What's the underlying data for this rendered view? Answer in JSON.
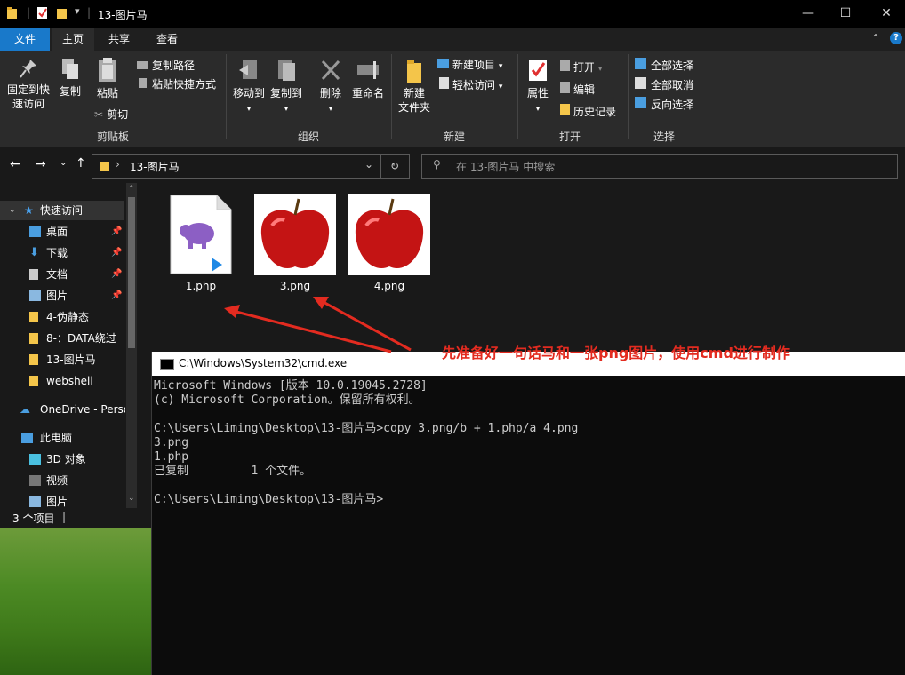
{
  "window": {
    "title": "13-图片马"
  },
  "ribbon_tabs": [
    "文件",
    "主页",
    "共享",
    "查看"
  ],
  "ribbon": {
    "pin_line1": "固定到快",
    "pin_line2": "速访问",
    "copy": "复制",
    "paste": "粘贴",
    "copy_path": "复制路径",
    "paste_shortcut": "粘贴快捷方式",
    "cut": "剪切",
    "group_clipboard": "剪贴板",
    "move_to": "移动到",
    "copy_to": "复制到",
    "delete": "删除",
    "rename": "重命名",
    "group_organize": "组织",
    "new_folder_line1": "新建",
    "new_folder_line2": "文件夹",
    "new_item": "新建项目",
    "easy_access": "轻松访问",
    "group_new": "新建",
    "properties": "属性",
    "open": "打开",
    "edit": "编辑",
    "history": "历史记录",
    "group_open": "打开",
    "select_all": "全部选择",
    "select_none": "全部取消",
    "invert_selection": "反向选择",
    "group_select": "选择"
  },
  "address": {
    "path": "13-图片马",
    "search_placeholder": "在 13-图片马 中搜索"
  },
  "sidebar": {
    "quick_access": "快速访问",
    "items": [
      {
        "label": "桌面",
        "pinned": true
      },
      {
        "label": "下载",
        "pinned": true
      },
      {
        "label": "文档",
        "pinned": true
      },
      {
        "label": "图片",
        "pinned": true
      },
      {
        "label": "4-伪静态",
        "pinned": false
      },
      {
        "label": "8-：DATA绕过",
        "pinned": false
      },
      {
        "label": "13-图片马",
        "pinned": false
      },
      {
        "label": "webshell",
        "pinned": false
      }
    ],
    "onedrive": "OneDrive - Perso",
    "this_pc": "此电脑",
    "pc_items": [
      "3D 对象",
      "视频",
      "图片"
    ]
  },
  "status": {
    "item_count": "3 个项目"
  },
  "files": [
    {
      "name": "1.php",
      "type": "php"
    },
    {
      "name": "3.png",
      "type": "png"
    },
    {
      "name": "4.png",
      "type": "png"
    }
  ],
  "annotation": "先准备好一句话马和一张png图片，使用cmd进行制作",
  "cmd": {
    "title": "C:\\Windows\\System32\\cmd.exe",
    "lines": [
      "Microsoft Windows [版本 10.0.19045.2728]",
      "(c) Microsoft Corporation。保留所有权利。",
      "",
      "C:\\Users\\Liming\\Desktop\\13-图片马>copy 3.png/b + 1.php/a 4.png",
      "3.png",
      "1.php",
      "已复制         1 个文件。",
      "",
      "C:\\Users\\Liming\\Desktop\\13-图片马>"
    ]
  },
  "colors": {
    "accent": "#1979ca",
    "annotation": "#e32b20",
    "folder": "#f4c54a"
  }
}
